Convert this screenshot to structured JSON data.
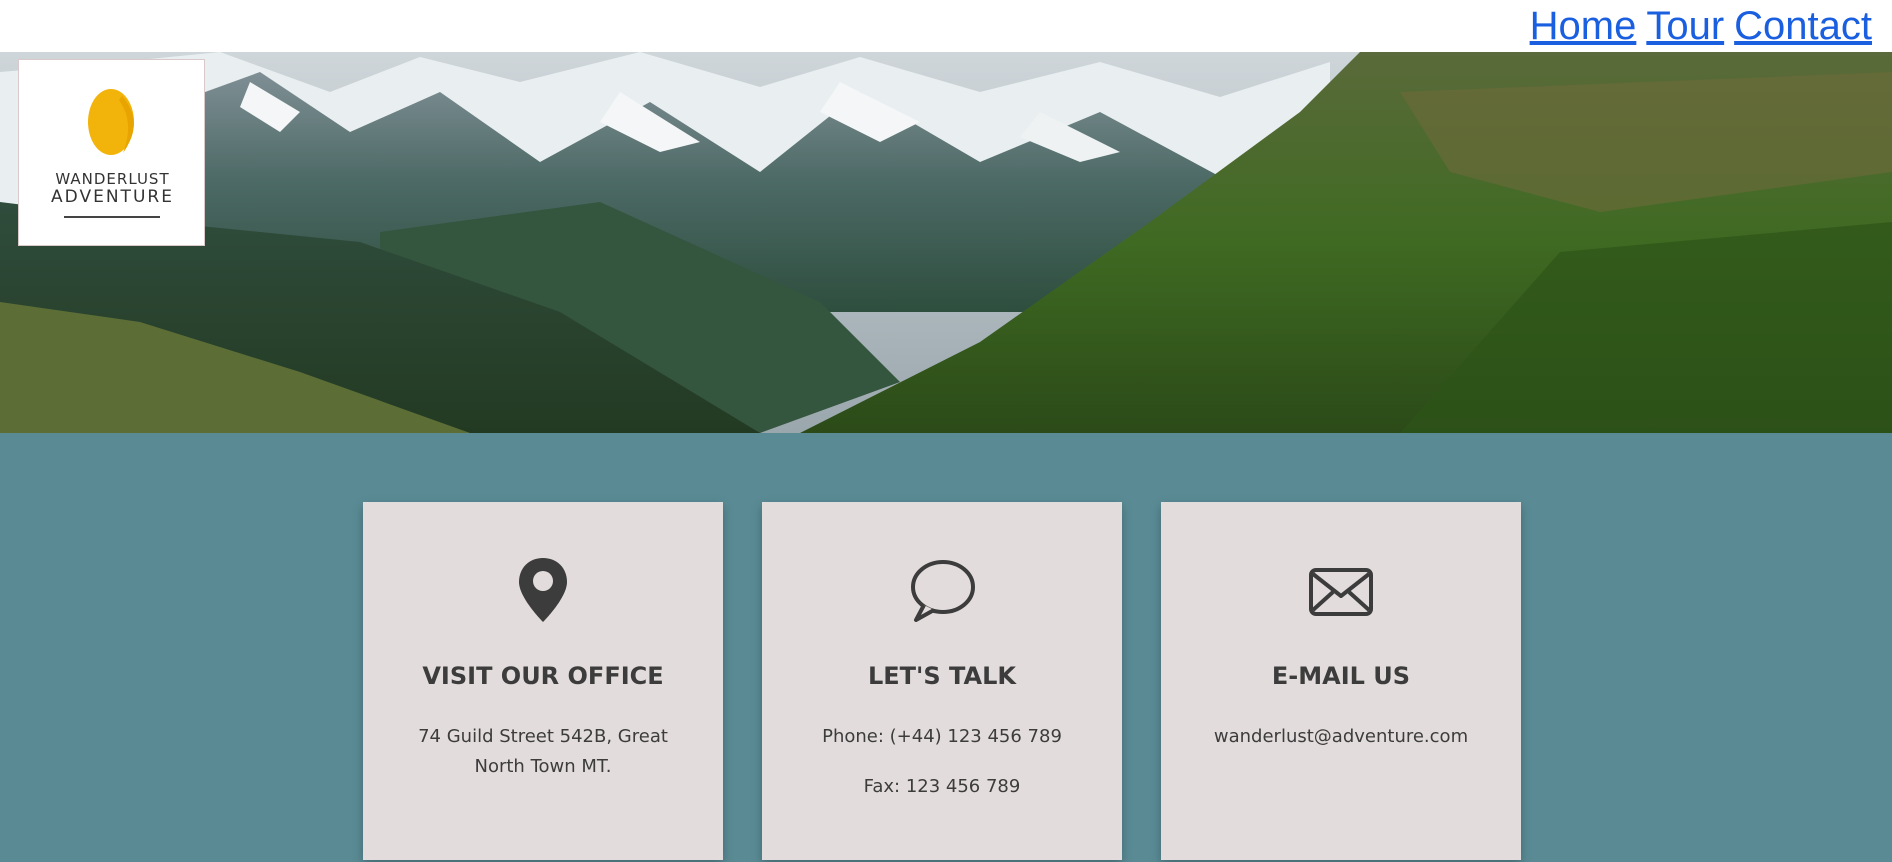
{
  "nav": {
    "items": [
      {
        "label": "Home"
      },
      {
        "label": "Tour"
      },
      {
        "label": "Contact"
      }
    ]
  },
  "logo": {
    "line1": "WANDERLUST",
    "line2": "ADVENTURE",
    "accent_color": "#f2b30a"
  },
  "hero": {
    "icon": "mountain-landscape"
  },
  "contact": {
    "cards": [
      {
        "icon": "map-pin-icon",
        "title": "VISIT OUR OFFICE",
        "lines": [
          "74 Guild Street 542B, Great North Town MT."
        ]
      },
      {
        "icon": "speech-bubble-icon",
        "title": "LET'S TALK",
        "lines": [
          "Phone: (+44) 123 456 789",
          "Fax: 123 456 789"
        ]
      },
      {
        "icon": "envelope-icon",
        "title": "E-MAIL US",
        "lines": [
          "wanderlust@adventure.com"
        ]
      }
    ]
  },
  "colors": {
    "band": "#5a8b95",
    "card": "#e3dcdc",
    "link": "#1a5fe0",
    "text": "#3c3c3c"
  }
}
